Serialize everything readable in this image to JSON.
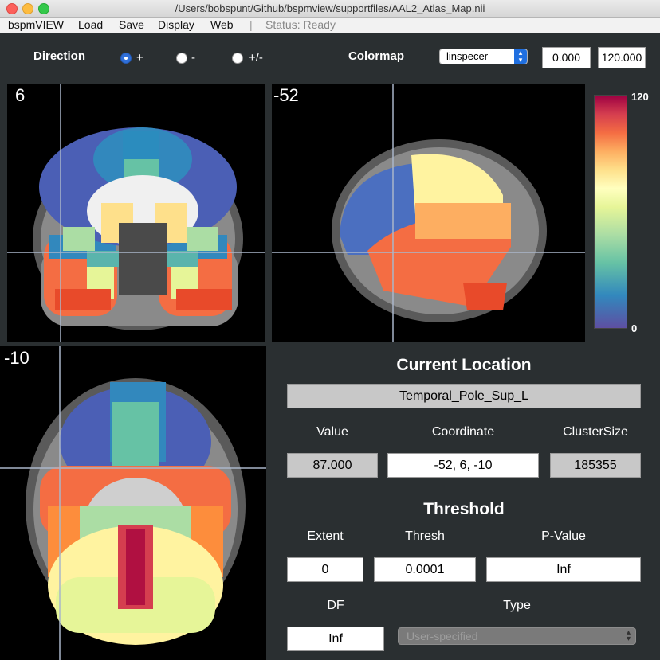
{
  "window": {
    "title": "/Users/bobspunt/Github/bspmview/supportfiles/AAL2_Atlas_Map.nii"
  },
  "menu": {
    "items": [
      "bspmVIEW",
      "Load",
      "Save",
      "Display",
      "Web"
    ],
    "separator": "|",
    "status": "Status: Ready"
  },
  "direction": {
    "label": "Direction",
    "options": [
      "+",
      "-",
      "+/-"
    ],
    "selected": "+"
  },
  "colormap": {
    "label": "Colormap",
    "selected": "linspecer",
    "min": "0.000",
    "max": "120.000"
  },
  "views": {
    "coronal": "6",
    "sagittal": "-52",
    "axial": "-10"
  },
  "colorbar": {
    "max": "120",
    "min": "0"
  },
  "current_location": {
    "heading": "Current Location",
    "region": "Temporal_Pole_Sup_L",
    "value_label": "Value",
    "value": "87.000",
    "coord_label": "Coordinate",
    "coord": "-52, 6, -10",
    "cluster_label": "ClusterSize",
    "cluster": "185355"
  },
  "threshold": {
    "heading": "Threshold",
    "extent_label": "Extent",
    "extent": "0",
    "thresh_label": "Thresh",
    "thresh": "0.0001",
    "pvalue_label": "P-Value",
    "pvalue": "Inf",
    "df_label": "DF",
    "df": "Inf",
    "type_label": "Type",
    "type": "User-specified"
  }
}
